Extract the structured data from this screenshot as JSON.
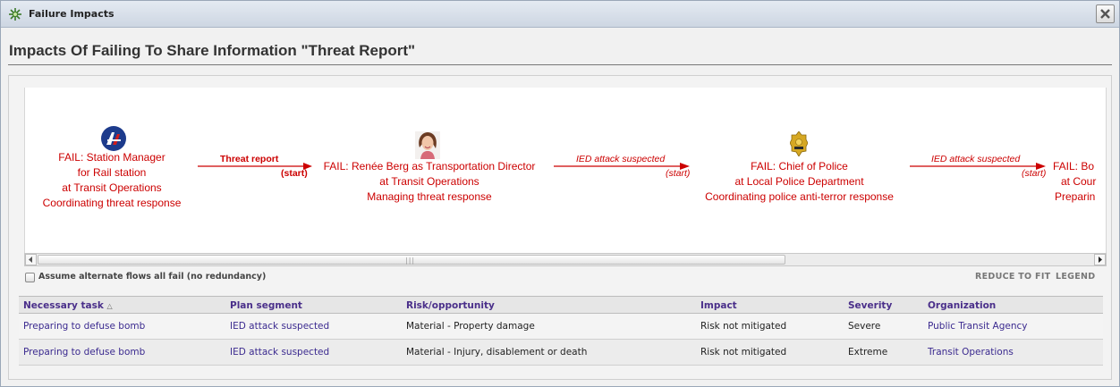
{
  "window": {
    "title": "Failure Impacts",
    "icon": "gear-network-icon",
    "close_icon": "close-icon"
  },
  "page": {
    "title": "Impacts Of Failing To Share Information \"Threat Report\""
  },
  "diagram": {
    "nodes": [
      {
        "icon": "transit-authority-logo-icon",
        "lines": [
          "FAIL: Station Manager",
          "for Rail station",
          "at Transit Operations",
          "Coordinating threat response"
        ]
      },
      {
        "icon": "person-photo-icon",
        "lines": [
          "FAIL: Renée Berg as Transportation Director",
          "at Transit Operations",
          "Managing threat response"
        ]
      },
      {
        "icon": "police-badge-icon",
        "lines": [
          "FAIL: Chief of Police",
          "at Local Police Department",
          "Coordinating police anti-terror response"
        ]
      },
      {
        "icon": "",
        "lines": [
          "FAIL: Bo",
          "at Cour",
          "Preparin"
        ]
      }
    ],
    "edges": [
      {
        "label": "Threat report",
        "start": "(start)"
      },
      {
        "label": "IED attack suspected",
        "start": "(start)"
      },
      {
        "label": "IED attack suspected",
        "start": "(start)"
      }
    ],
    "color": "#cc0000"
  },
  "options": {
    "alternate_flows_label": "Assume alternate flows all fail (no redundancy)",
    "alternate_flows_checked": false,
    "reduce_to_fit": "REDUCE TO FIT",
    "legend": "LEGEND"
  },
  "table": {
    "columns": [
      "Necessary task",
      "Plan segment",
      "Risk/opportunity",
      "Impact",
      "Severity",
      "Organization"
    ],
    "sorted_column": "Necessary task",
    "rows": [
      [
        "Preparing to defuse bomb",
        "IED attack suspected",
        "Material - Property damage",
        "Risk not mitigated",
        "Severe",
        "Public Transit Agency"
      ],
      [
        "Preparing to defuse bomb",
        "IED attack suspected",
        "Material - Injury, disablement or death",
        "Risk not mitigated",
        "Extreme",
        "Transit Operations"
      ]
    ]
  },
  "colors": {
    "fail_text": "#cc0000",
    "link": "#3b2a8f",
    "header_link": "#4a2f8a"
  }
}
